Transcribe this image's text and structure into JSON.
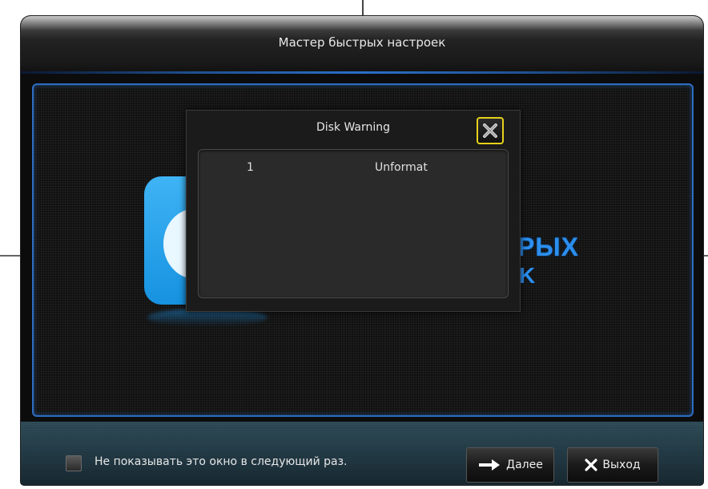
{
  "window": {
    "title": "Мастер быстрых настроек"
  },
  "background": {
    "heading_fragment": "PЫХ",
    "heading_fragment_2": "K"
  },
  "dialog": {
    "title": "Disk Warning",
    "close_icon": "close-icon",
    "rows": [
      {
        "number": "1",
        "status": "Unformat"
      }
    ]
  },
  "footer": {
    "checkbox_label": "Не показывать это окно в следующий раз.",
    "checkbox_checked": false,
    "next_label": "Далее",
    "next_icon": "arrow-right-icon",
    "exit_label": "Выход",
    "exit_icon": "close-icon"
  },
  "colors": {
    "accent_blue": "#2b6fc7",
    "close_highlight": "#e6d21a",
    "logo_blue": "#1692e0"
  }
}
